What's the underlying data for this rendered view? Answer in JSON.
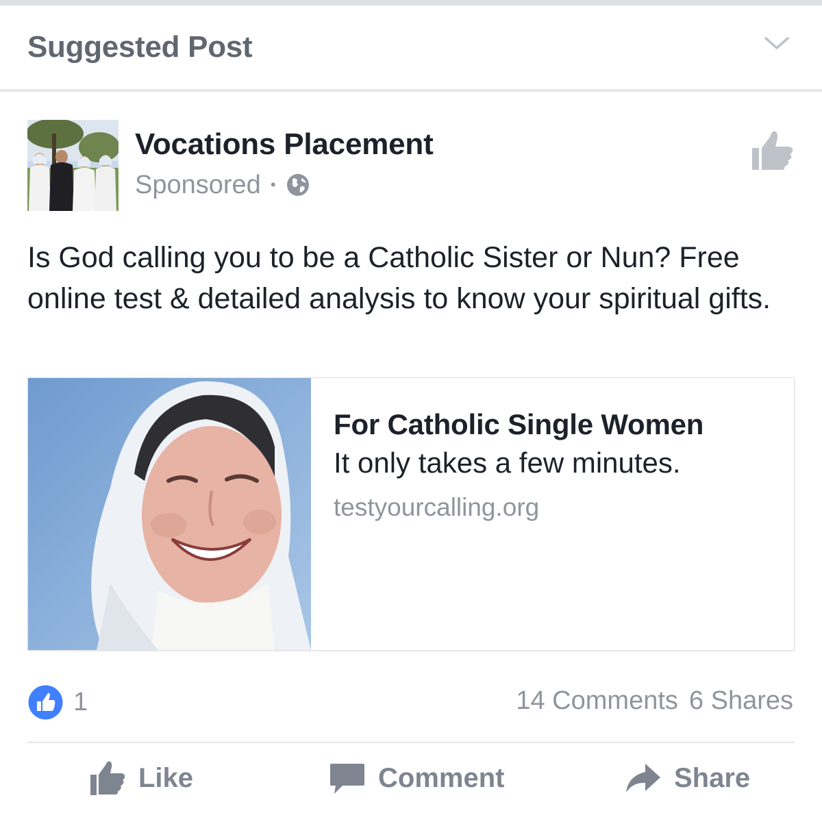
{
  "header": {
    "title": "Suggested Post"
  },
  "post": {
    "page_name": "Vocations Placement",
    "sponsored_label": "Sponsored",
    "separator": "•",
    "text": "Is God  calling you to be a Catholic Sister or Nun? Free online test & detailed analysis to know your spiritual gifts."
  },
  "link_card": {
    "title": "For Catholic Single Women",
    "description": "It only takes a few minutes.",
    "domain": "testyourcalling.org"
  },
  "stats": {
    "like_count": "1",
    "comments": "14 Comments",
    "shares": "6 Shares"
  },
  "actions": {
    "like": "Like",
    "comment": "Comment",
    "share": "Share"
  },
  "colors": {
    "facebook_blue": "#4080ff",
    "icon_gray": "#7f8590",
    "meta_gray": "#90949c"
  },
  "icons": [
    "chevron-down-icon",
    "globe-icon",
    "thumbs-up-icon",
    "comment-icon",
    "share-arrow-icon"
  ]
}
